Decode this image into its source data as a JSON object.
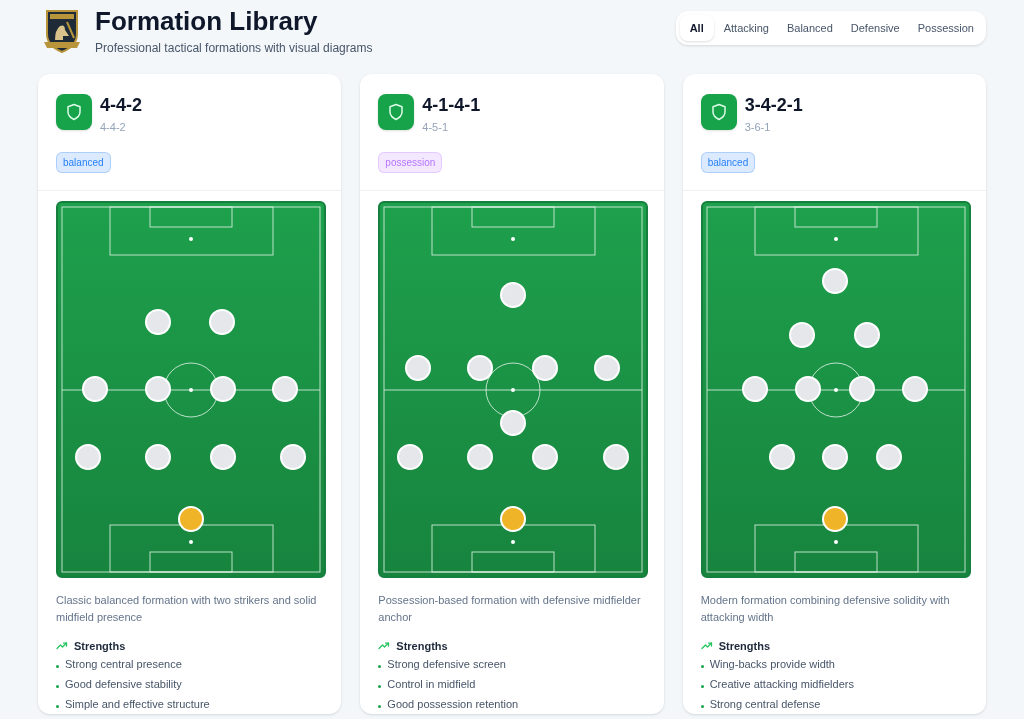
{
  "header": {
    "title": "Formation Library",
    "subtitle": "Professional tactical formations with visual diagrams"
  },
  "filters": [
    {
      "label": "All",
      "selected": true
    },
    {
      "label": "Attacking",
      "selected": false
    },
    {
      "label": "Balanced",
      "selected": false
    },
    {
      "label": "Defensive",
      "selected": false
    },
    {
      "label": "Possession",
      "selected": false
    }
  ],
  "formations": [
    {
      "name": "4-4-2",
      "subtitle": "4-4-2",
      "tag": "balanced",
      "color": "#dbeafe",
      "description": "Classic balanced formation with two strikers and solid midfield presence",
      "strengths_title": "Strengths",
      "strengths": [
        "Strong central presence",
        "Good defensive stability",
        "Simple and effective structure"
      ]
    },
    {
      "name": "4-1-4-1",
      "subtitle": "4-5-1",
      "tag": "possession",
      "color": "#f3e8ff",
      "description": "Possession-based formation with defensive midfielder anchor",
      "strengths_title": "Strengths",
      "strengths": [
        "Strong defensive screen",
        "Control in midfield",
        "Good possession retention"
      ]
    },
    {
      "name": "3-4-2-1",
      "subtitle": "3-6-1",
      "tag": "balanced",
      "color": "#dbeafe",
      "description": "Modern formation combining defensive solidity with attacking width",
      "strengths_title": "Strengths",
      "strengths": [
        "Wing-backs provide width",
        "Creative attacking midfielders",
        "Strong central defense"
      ]
    }
  ]
}
